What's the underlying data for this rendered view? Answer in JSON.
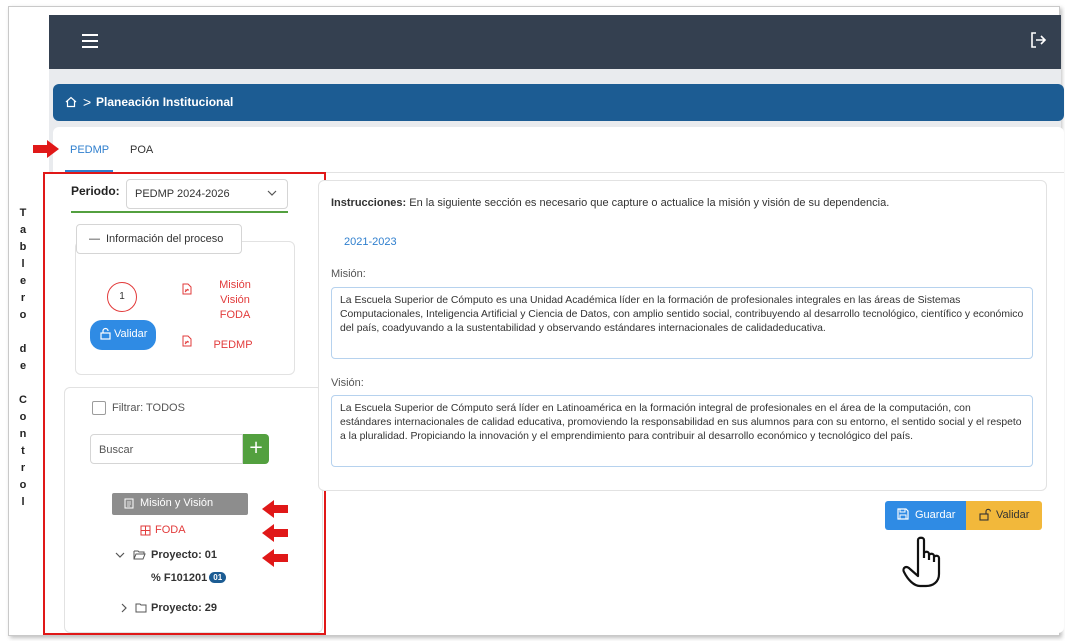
{
  "topbar": {
    "menu_icon": "hamburger-icon",
    "logout_icon": "logout-icon",
    "bg_color": "#344050"
  },
  "breadcrumb": {
    "home_icon": "home-icon",
    "separator": ">",
    "current": "Planeación Institucional",
    "bg_color": "#1c5c93"
  },
  "tabs": [
    {
      "label": "PEDMP",
      "active": true
    },
    {
      "label": "POA",
      "active": false
    }
  ],
  "side_label": [
    "T",
    "a",
    "b",
    "l",
    "e",
    "r",
    "o",
    "",
    "d",
    "e",
    "",
    "C",
    "o",
    "n",
    "t",
    "r",
    "o",
    "l"
  ],
  "sidebar": {
    "periodo_label": "Periodo:",
    "periodo_value": "PEDMP 2024-2026",
    "info_button": "Información del proceso",
    "step_number": "1",
    "documents": [
      {
        "label": "Misión\nVisión\nFODA"
      },
      {
        "label": "PEDMP"
      }
    ],
    "validar_button": "Validar",
    "filter_label": "Filtrar: TODOS",
    "search_placeholder": "Buscar",
    "tree": {
      "mision_vision": "Misión y Visión",
      "foda": "FODA",
      "proyecto_01": "Proyecto: 01",
      "f101201": "F101201",
      "f101201_badge": "01",
      "proyecto_29": "Proyecto: 29"
    }
  },
  "main": {
    "instructions_label": "Instrucciones:",
    "instructions_text": " En la siguiente sección es necesario que capture o actualice la misión y visión de su dependencia.",
    "year_link": "2021-2023",
    "mision_label": "Misión:",
    "mision_text": "La Escuela Superior de Cómputo es una Unidad Académica líder en la formación de profesionales integrales en las áreas de Sistemas Computacionales, Inteligencia Artificial y Ciencia de Datos, con amplio sentido social, contribuyendo al desarrollo tecnológico, científico y económico del país, coadyuvando a la sustentabilidad y observando estándares internacionales de calidadeducativa.",
    "vision_label": "Visión:",
    "vision_text": "La Escuela Superior de Cómputo será líder en Latinoamérica en la formación integral de profesionales en el área de la computación, con estándares internacionales de calidad educativa, promoviendo la responsabilidad en sus alumnos para con su entorno, el sentido social y el respeto a la pluralidad. Propiciando la innovación y el emprendimiento para contribuir al desarrollo económico y tecnológico del país.",
    "guardar_button": "Guardar",
    "validar_button": "Validar"
  },
  "colors": {
    "accent_blue": "#2f8be4",
    "highlight_red": "#e01818",
    "validar_yellow": "#f2b83b",
    "plus_green": "#53a03f"
  }
}
